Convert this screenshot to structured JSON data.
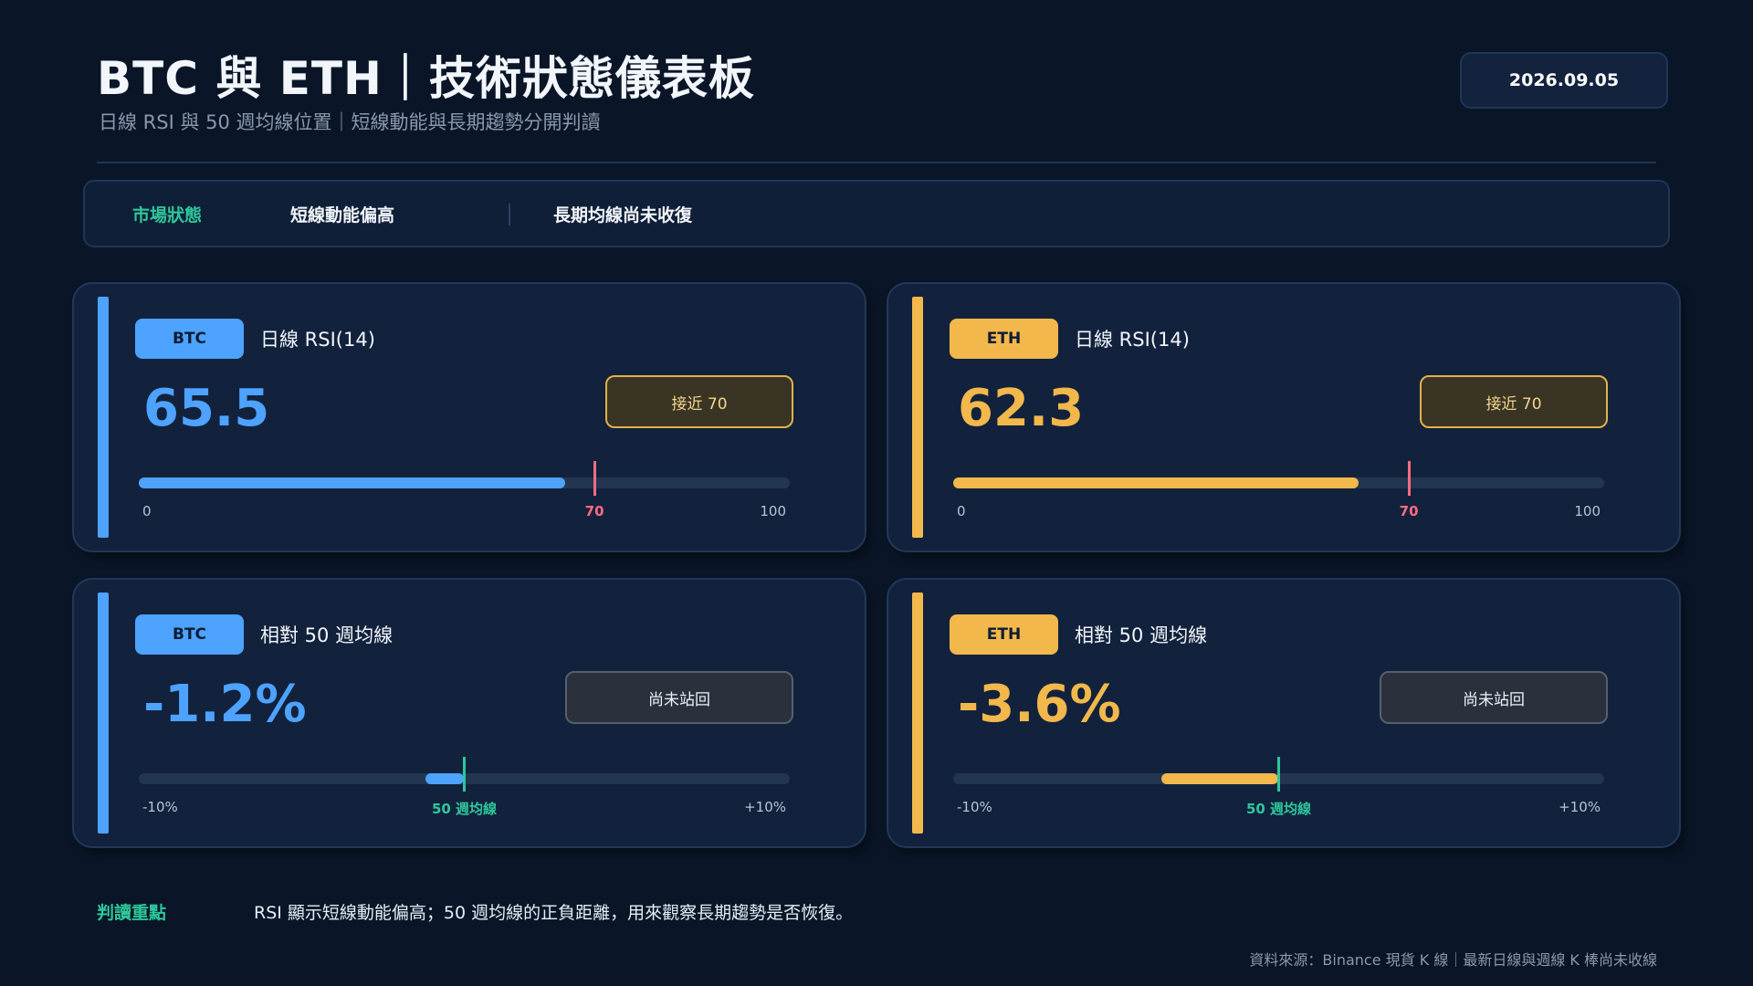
{
  "header": {
    "title": "BTC 與 ETH｜技術狀態儀表板",
    "subtitle": "日線 RSI 與 50 週均線位置｜短線動能與長期趨勢分開判讀",
    "date": "2026.09.05"
  },
  "status": {
    "label": "市場狀態",
    "short_term": "短線動能偏高",
    "long_term": "長期均線尚未收復"
  },
  "colors": {
    "btc": "#4da3ff",
    "eth": "#f2b84b",
    "rsi_marker": "#ff6b81",
    "ma_marker": "#2ec79b"
  },
  "cards": [
    {
      "asset": "BTC",
      "metric": "日線 RSI(14)",
      "value": "65.5",
      "badge": "接近 70",
      "kind": "rsi",
      "level": 65.5,
      "scale_min": 0,
      "scale_max": 100,
      "marker": 70,
      "ticks": [
        "0",
        "70",
        "100"
      ]
    },
    {
      "asset": "ETH",
      "metric": "日線 RSI(14)",
      "value": "62.3",
      "badge": "接近 70",
      "kind": "rsi",
      "level": 62.3,
      "scale_min": 0,
      "scale_max": 100,
      "marker": 70,
      "ticks": [
        "0",
        "70",
        "100"
      ]
    },
    {
      "asset": "BTC",
      "metric": "相對 50 週均線",
      "value": "-1.2%",
      "badge": "尚未站回",
      "kind": "ma",
      "level": -1.2,
      "scale_min": -10,
      "scale_max": 10,
      "marker": 0,
      "ticks": [
        "-10%",
        "50 週均線",
        "+10%"
      ]
    },
    {
      "asset": "ETH",
      "metric": "相對 50 週均線",
      "value": "-3.6%",
      "badge": "尚未站回",
      "kind": "ma",
      "level": -3.6,
      "scale_min": -10,
      "scale_max": 10,
      "marker": 0,
      "ticks": [
        "-10%",
        "50 週均線",
        "+10%"
      ]
    }
  ],
  "footer": {
    "label": "判讀重點",
    "text": "RSI 顯示短線動能偏高；50 週均線的正負距離，用來觀察長期趨勢是否恢復。",
    "source": "資料來源：Binance 現貨 K 線｜最新日線與週線 K 棒尚未收線"
  }
}
